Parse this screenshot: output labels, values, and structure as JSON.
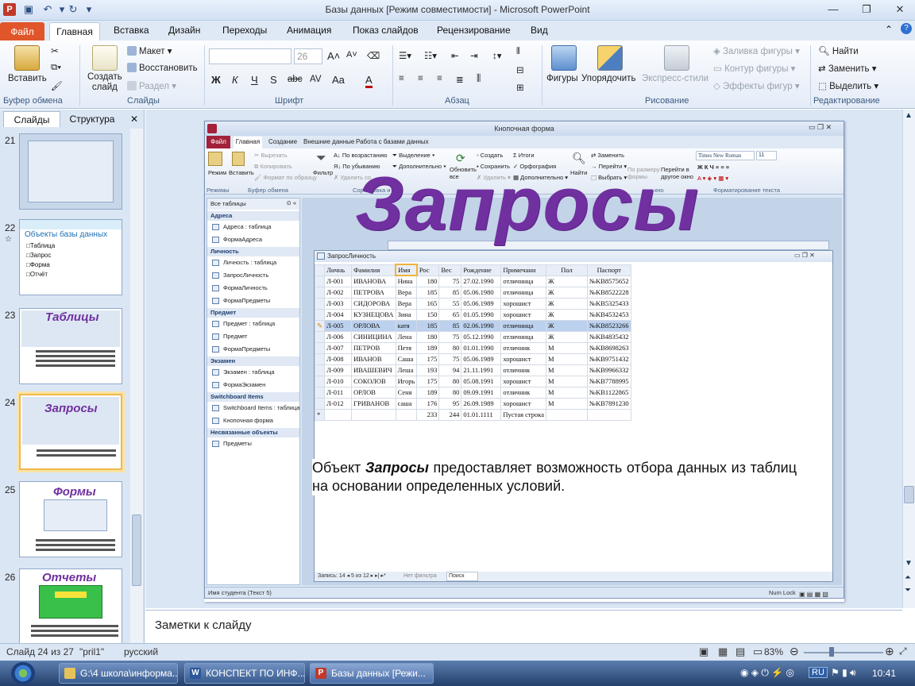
{
  "window": {
    "title": "Базы данных [Режим совместимости]  -  Microsoft PowerPoint"
  },
  "tabs": [
    {
      "label": "Файл"
    },
    {
      "label": "Главная"
    },
    {
      "label": "Вставка"
    },
    {
      "label": "Дизайн"
    },
    {
      "label": "Переходы"
    },
    {
      "label": "Анимация"
    },
    {
      "label": "Показ слайдов"
    },
    {
      "label": "Рецензирование"
    },
    {
      "label": "Вид"
    }
  ],
  "ribbon": {
    "clipboard": {
      "paste": "Вставить",
      "group": "Буфер обмена"
    },
    "slides": {
      "new_slide": "Создать\nслайд",
      "layout": "Макет",
      "reset": "Восстановить",
      "section": "Раздел",
      "group": "Слайды"
    },
    "font": {
      "size": "26",
      "group": "Шрифт",
      "buttons": [
        "Ж",
        "К",
        "Ч",
        "S",
        "abc",
        "AV",
        "Aa",
        "A"
      ]
    },
    "paragraph": {
      "group": "Абзац"
    },
    "drawing": {
      "shapes": "Фигуры",
      "arrange": "Упорядочить",
      "quick_styles": "Экспресс-стили",
      "fill": "Заливка фигуры",
      "outline": "Контур фигуры",
      "effects": "Эффекты фигур",
      "group": "Рисование"
    },
    "editing": {
      "find": "Найти",
      "replace": "Заменить",
      "select": "Выделить",
      "group": "Редактирование"
    }
  },
  "left_panel": {
    "tabs": [
      {
        "label": "Слайды"
      },
      {
        "label": "Структура"
      }
    ],
    "slides": [
      {
        "number": "21",
        "title": "",
        "items": []
      },
      {
        "number": "22",
        "title": "Объекты базы данных",
        "items": [
          "Таблица",
          "Запрос",
          "Форма",
          "Отчёт"
        ]
      },
      {
        "number": "23",
        "title": "Таблицы",
        "items": []
      },
      {
        "number": "24",
        "title": "Запросы",
        "items": []
      },
      {
        "number": "25",
        "title": "Формы",
        "items": []
      },
      {
        "number": "26",
        "title": "Отчеты",
        "items": []
      }
    ]
  },
  "slide": {
    "title": "Запросы",
    "body_prefix": "Объект ",
    "body_emph": "Запросы",
    "body_rest": " предоставляет возможность отбора данных из таблиц на основании определенных условий."
  },
  "access": {
    "title": "Кнопочная форма",
    "tabs": [
      {
        "label": "Файл"
      },
      {
        "label": "Главная"
      },
      {
        "label": "Создание"
      },
      {
        "label": "Внешние данные"
      },
      {
        "label": "Работа с базами данных"
      }
    ],
    "ribbon": {
      "view": "Режим",
      "paste": "Вставить",
      "cut": "Вырезать",
      "copy": "Копировать",
      "format_painter": "Формат по образцу",
      "filter": "Фильтр",
      "asc": "По возрастанию",
      "desc": "По убыванию",
      "remove_sort": "Удалить со",
      "selection": "Выделение",
      "advanced": "Дополнительно",
      "refresh": "Обновить\nвсе",
      "new": "Создать",
      "save": "Сохранить",
      "delete": "Удалить",
      "totals": "Итоги",
      "spelling": "Орфография",
      "more": "Дополнительно",
      "find": "Найти",
      "replace": "Заменить",
      "goto": "Перейти",
      "select": "Выбрать",
      "fit": "По размеру\nформы",
      "switch": "Перейти в\nдругое окно",
      "font": "Times New Roman",
      "font_size": "11",
      "groups": {
        "views": "Режимы",
        "clipboard": "Буфер обмена",
        "sort": "Сортировка и фи",
        "records": "иси",
        "window": "кно",
        "text": "Форматирование текста"
      }
    },
    "nav": {
      "header": "Все таблицы",
      "groups": [
        {
          "name": "Адреса",
          "items": [
            "Адреса : таблица",
            "ФормаАдреса"
          ]
        },
        {
          "name": "Личность",
          "items": [
            "Личность : таблица",
            "ЗапросЛичность",
            "ФормаЛичность",
            "ФормаПредметы"
          ]
        },
        {
          "name": "Предмет",
          "items": [
            "Предмет : таблица",
            "Предмет",
            "ФормаПредметы"
          ]
        },
        {
          "name": "Экзамен",
          "items": [
            "Экзамен : таблица",
            "ФормаЭкзамен"
          ]
        },
        {
          "name": "Switchboard Items",
          "items": [
            "Switchboard Items : таблица",
            "Кнопочная форма"
          ]
        },
        {
          "name": "Несвязанные объекты",
          "items": [
            "Предметы"
          ]
        }
      ]
    },
    "query": {
      "title": "ЗапросЛичность",
      "columns": [
        "Личнь",
        "Фамилия",
        "Имя",
        "Рос",
        "Вес",
        "Рождение",
        "Примечани",
        "Пол",
        "Паспорт"
      ],
      "rows": [
        [
          "Л-001",
          "ИВАНОВА",
          "Нина",
          "180",
          "75",
          "27.02.1990",
          "отличница",
          "Ж",
          "№KB8575652"
        ],
        [
          "Л-002",
          "ПЕТРОВА",
          "Вера",
          "185",
          "85",
          "05.06.1980",
          "отличница",
          "Ж",
          "№KB8522228"
        ],
        [
          "Л-003",
          "СИДОРОВА",
          "Вера",
          "165",
          "55",
          "05.06.1989",
          "хорошист",
          "Ж",
          "№KB5325433"
        ],
        [
          "Л-004",
          "КУЗНЕЦОВА",
          "Зина",
          "150",
          "65",
          "01.05.1990",
          "хорошист",
          "Ж",
          "№KB4532453"
        ],
        [
          "Л-005",
          "ОРЛОВА",
          "катя",
          "185",
          "85",
          "02.06.1990",
          "отличница",
          "Ж",
          "№KB8523266"
        ],
        [
          "Л-006",
          "СИНИЦИНА",
          "Лена",
          "180",
          "75",
          "05.12.1990",
          "отличница",
          "Ж",
          "№KB4835432"
        ],
        [
          "Л-007",
          "ПЕТРОВ",
          "Петя",
          "189",
          "80",
          "01.01.1990",
          "отличник",
          "М",
          "№KB8698263"
        ],
        [
          "Л-008",
          "ИВАНОВ",
          "Саша",
          "175",
          "75",
          "05.06.1989",
          "хорошист",
          "М",
          "№KB9751432"
        ],
        [
          "Л-009",
          "ИВАШЕВИЧ",
          "Леша",
          "193",
          "94",
          "21.11.1991",
          "отличник",
          "М",
          "№KB9966332"
        ],
        [
          "Л-010",
          "СОКОЛОВ",
          "Игорь",
          "175",
          "80",
          "05.08.1991",
          "хорошист",
          "М",
          "№KB7788995"
        ],
        [
          "Л-011",
          "ОРЛОВ",
          "Сеня",
          "189",
          "80",
          "09.09.1991",
          "отличник",
          "М",
          "№KB1122865"
        ],
        [
          "Л-012",
          "ГРИВАНОВ",
          "саша",
          "176",
          "95",
          "26.09.1989",
          "хорошист",
          "М",
          "№KB7891230"
        ]
      ],
      "new_row": [
        "",
        "",
        "",
        "233",
        "244",
        "01.01.1111",
        "Пустая строка",
        "",
        ""
      ],
      "record_nav": "Запись: 14 ◂ 5 из 12 ▸ ▸| ▸*",
      "no_filter": "Нет фильтра",
      "search": "Поиск"
    },
    "status_left": "Имя студента (Текст 5)",
    "status_right": "Num Lock"
  },
  "notes": {
    "placeholder": "Заметки к слайду"
  },
  "status": {
    "slide": "Слайд 24 из 27",
    "theme": "\"pril1\"",
    "language": "русский",
    "zoom": "83%"
  },
  "taskbar": {
    "tasks": [
      {
        "label": "G:\\4 школа\\информа..."
      },
      {
        "label": "КОНСПЕКТ ПО ИНФ..."
      },
      {
        "label": "Базы данных [Режи..."
      }
    ],
    "lang": "RU",
    "time": "10:41"
  },
  "colors": {
    "accent_file": "#e0562a",
    "title_purple": "#7030a0",
    "thumb_sel": "#f1b84a"
  }
}
